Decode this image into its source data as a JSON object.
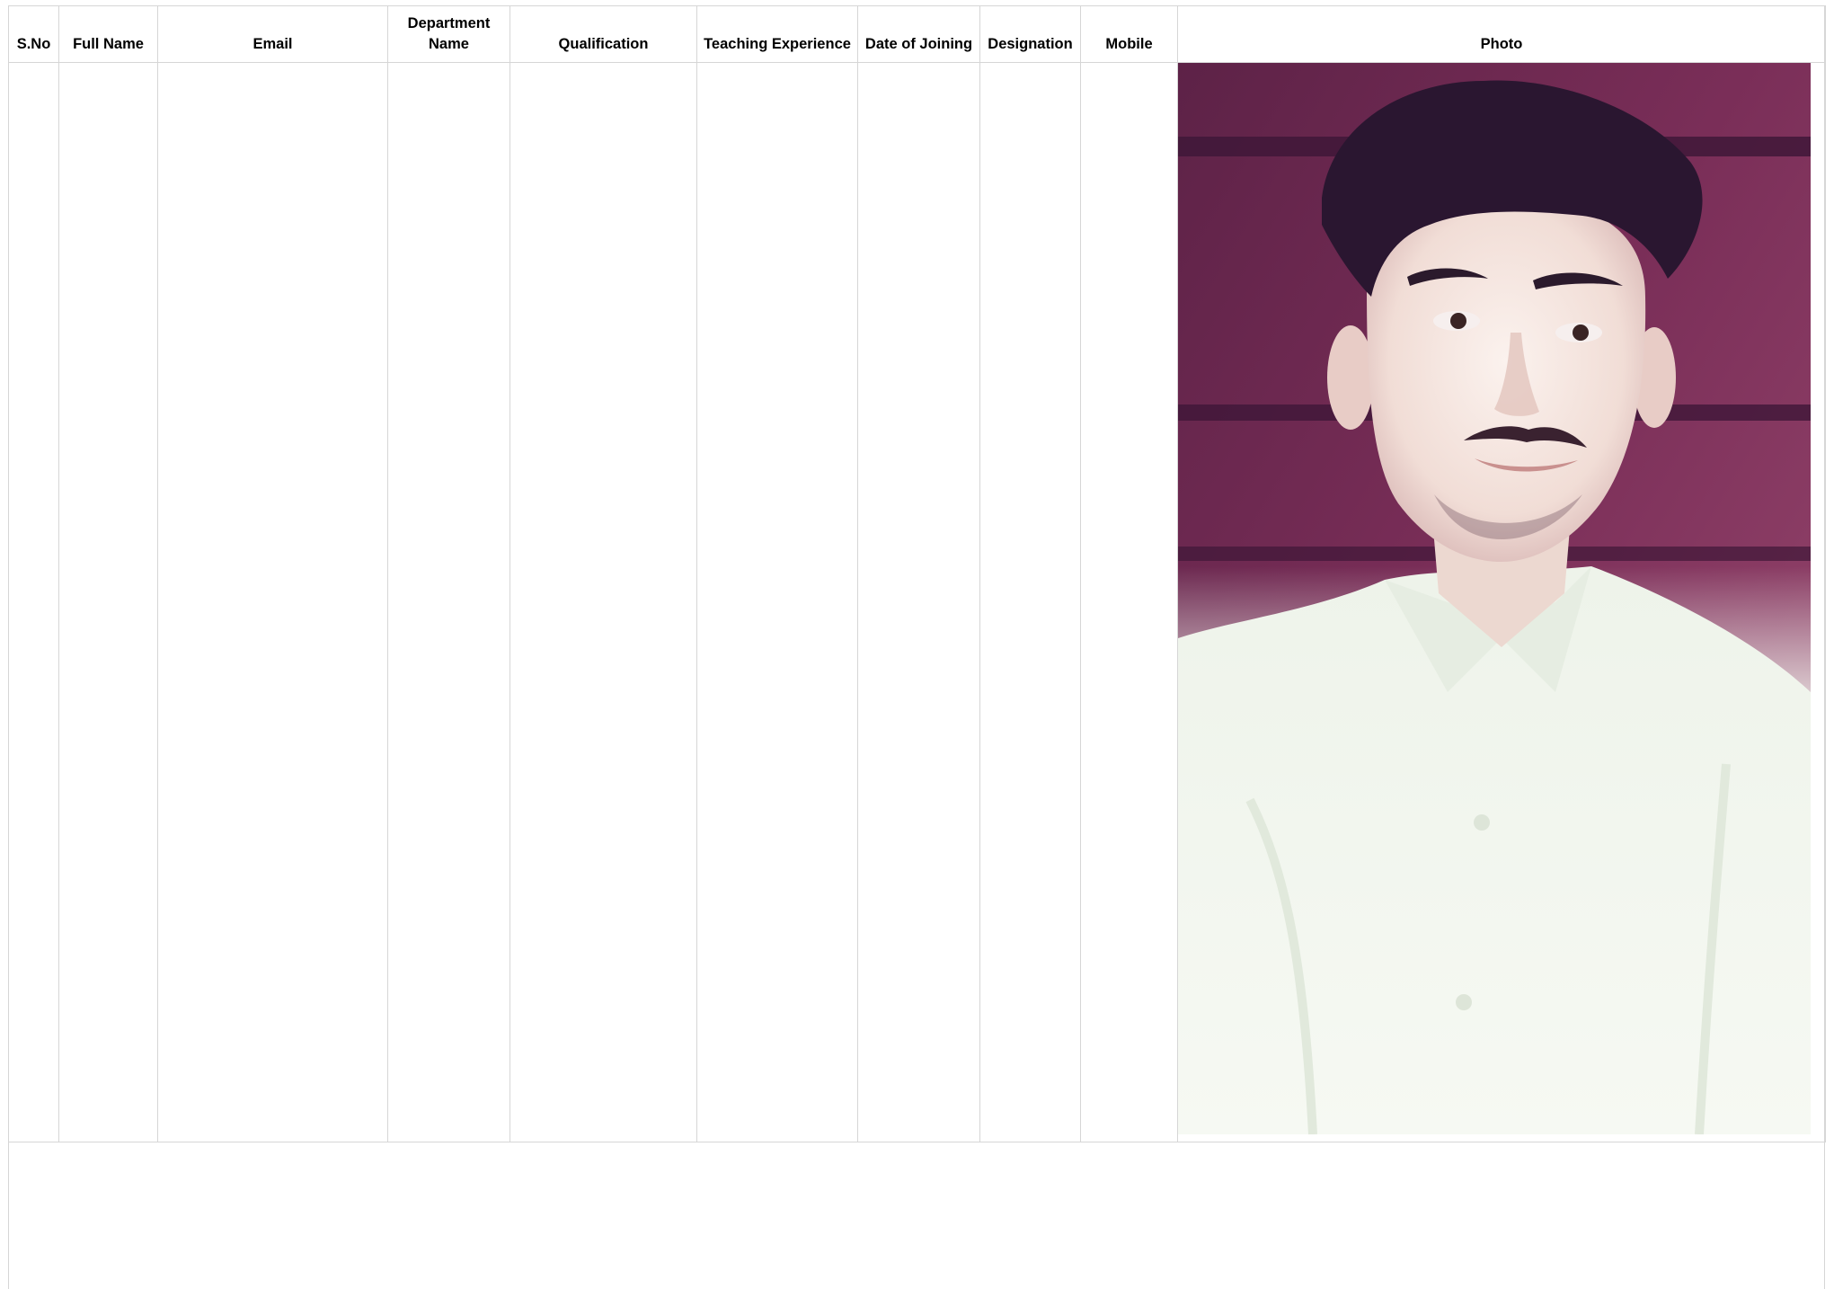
{
  "table": {
    "headers": {
      "sno": "S.No",
      "full_name": "Full Name",
      "email": "Email",
      "department_line1": "Department",
      "department_line2": "Name",
      "qualification": "Qualification",
      "teaching_experience": "Teaching Experience",
      "date_of_joining": "Date of Joining",
      "designation": "Designation",
      "mobile": "Mobile",
      "photo": "Photo"
    },
    "rows": [
      {
        "sno": "",
        "full_name": "",
        "email": "",
        "department_name": "",
        "qualification": "",
        "teaching_experience": "",
        "date_of_joining": "",
        "designation": "",
        "mobile": "",
        "photo": "portrait-photo"
      }
    ]
  },
  "colors": {
    "grid_border": "#d6d6d6",
    "photo_background": "#6e2a52",
    "photo_shirt": "#f2f6ef"
  }
}
